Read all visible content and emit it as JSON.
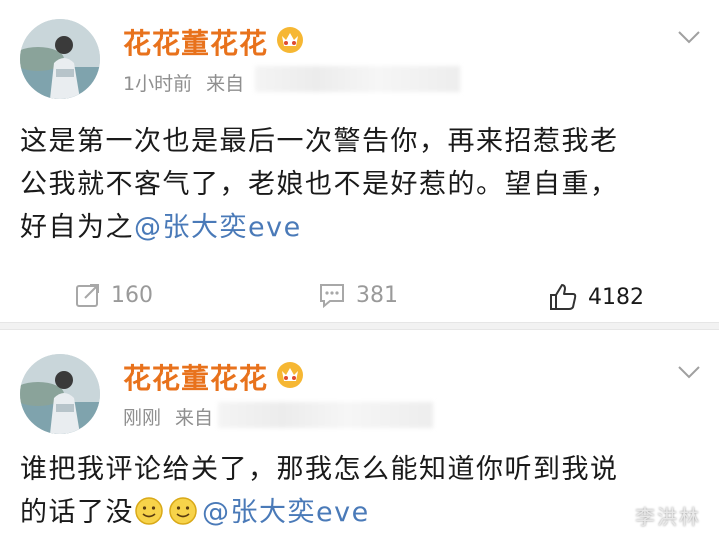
{
  "posts": [
    {
      "username": "花花董花花",
      "time": "1小时前",
      "source_prefix": "来自",
      "content_lines": [
        "这是第一次也是最后一次警告你，再来招惹我老",
        "公我就不客气了，老娘也不是好惹的。望自重，",
        "好自为之"
      ],
      "mention": "@张大奕eve",
      "actions": {
        "repost_count": "160",
        "comment_count": "381",
        "like_count": "4182"
      }
    },
    {
      "username": "花花董花花",
      "time": "刚刚",
      "source_prefix": "来自",
      "content_lines": [
        "谁把我评论给关了，那我怎么能知道你听到我说",
        "的话了没"
      ],
      "emojis": [
        "smile-emoji",
        "smile-emoji"
      ],
      "mention": "@张大奕eve"
    }
  ],
  "watermark": "李洪林",
  "colors": {
    "username": "#e8721c",
    "mention": "#4a7ab8",
    "meta": "#8f8f8f"
  }
}
